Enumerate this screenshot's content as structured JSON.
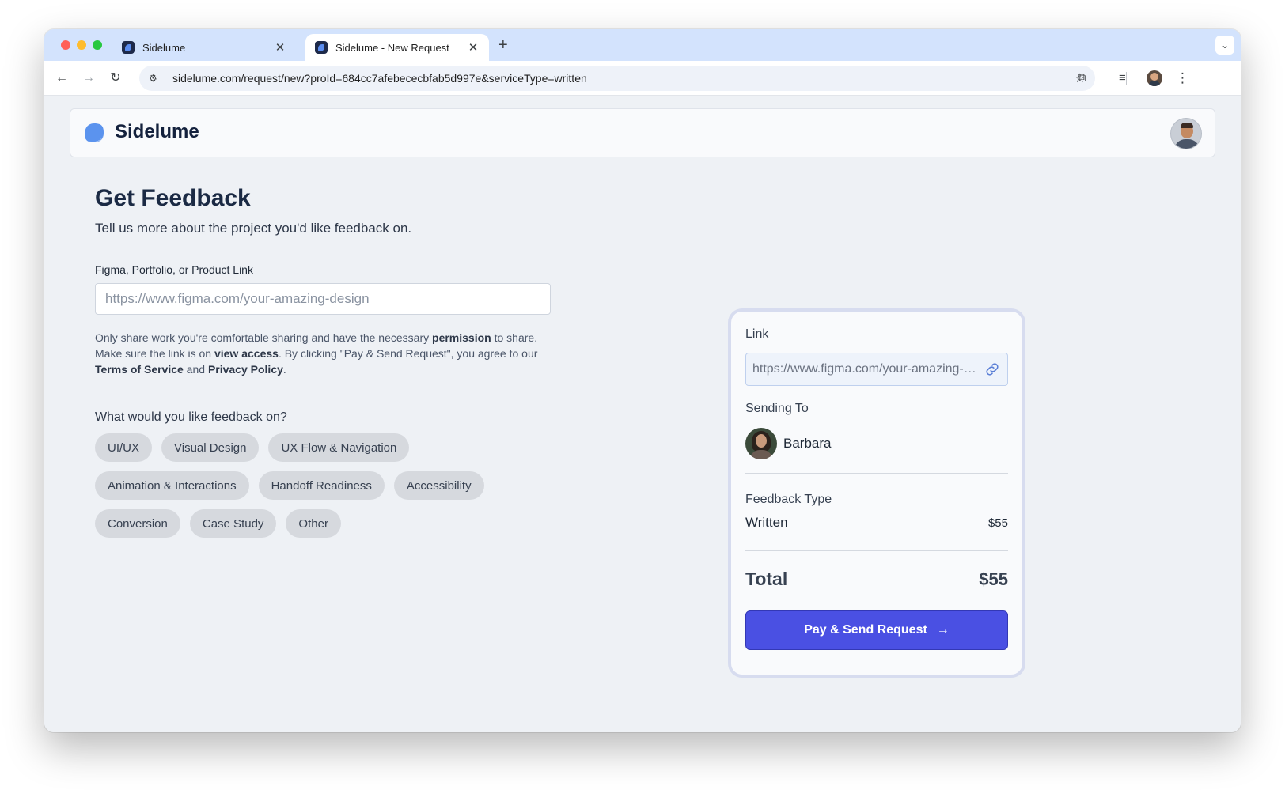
{
  "browser": {
    "tabs": [
      {
        "title": "Sidelume",
        "close": "✕"
      },
      {
        "title": "Sidelume - New Request",
        "close": "✕"
      }
    ],
    "new_tab": "+",
    "tab_menu": "⌄",
    "url": "sidelume.com/request/new?proId=684cc7afebececbfab5d997e&serviceType=written",
    "icons": {
      "back": "←",
      "forward": "→",
      "reload": "↻",
      "site_info": "⚙",
      "star": "☆",
      "extensions": "⧉",
      "media": "≡",
      "more": "⋮"
    }
  },
  "app": {
    "name": "Sidelume",
    "accent": "#4a50e3"
  },
  "form": {
    "title": "Get Feedback",
    "subtitle": "Tell us more about the project you'd like feedback on.",
    "link_label": "Figma, Portfolio, or Product Link",
    "link_placeholder": "https://www.figma.com/your-amazing-design",
    "note": {
      "p1": "Only share work you're comfortable sharing and have the necessary ",
      "b1": "permission",
      "p2": " to share. Make sure the link is on ",
      "b2": "view access",
      "p3": ". By clicking \"Pay & Send Request\", you agree to our ",
      "b3": "Terms of Service",
      "p4": " and ",
      "b4": "Privacy Policy",
      "p5": "."
    },
    "question": "What would you like feedback on?",
    "topics": [
      "UI/UX",
      "Visual Design",
      "UX Flow & Navigation",
      "Animation & Interactions",
      "Handoff Readiness",
      "Accessibility",
      "Conversion",
      "Case Study",
      "Other"
    ]
  },
  "summary": {
    "link_label": "Link",
    "link_value": "https://www.figma.com/your-amazing-design",
    "sending_label": "Sending To",
    "recipient": "Barbara",
    "type_label": "Feedback Type",
    "type_value": "Written",
    "type_price": "$55",
    "total_label": "Total",
    "total_value": "$55",
    "pay_label": "Pay & Send Request",
    "pay_arrow": "→"
  }
}
